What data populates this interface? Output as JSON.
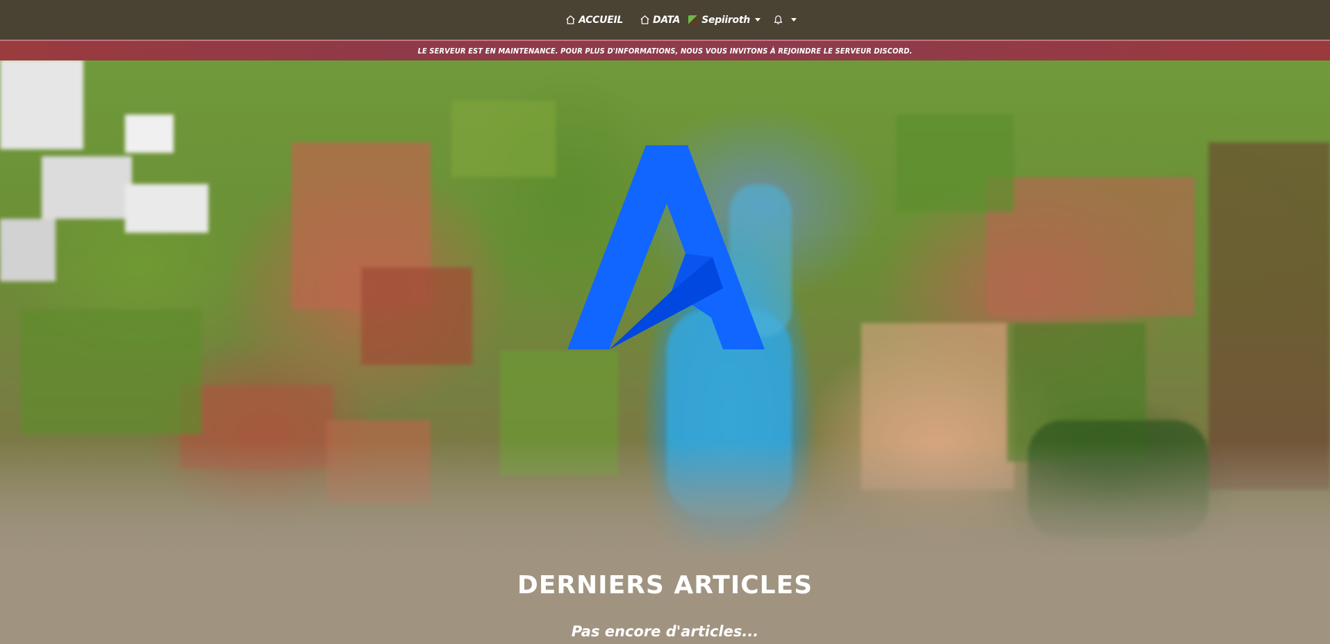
{
  "navbar": {
    "home_label": "ACCUEIL",
    "data_label": "DATA",
    "username": "Sepiiroth",
    "home_icon": "home-icon",
    "data_icon": "home-icon",
    "bell_icon": "bell-icon"
  },
  "banner": {
    "text": "Le serveur est en maintenance. Pour plus d'informations, nous vous invitons à rejoindre le serveur Discord."
  },
  "articles": {
    "title": "DERNIERS ARTICLES",
    "empty_message": "Pas encore d'articles..."
  },
  "colors": {
    "navbar_bg": "#4a4233",
    "banner_bg": "#8f3a49",
    "page_bg": "#a09481",
    "logo_blue": "#1166ff"
  }
}
